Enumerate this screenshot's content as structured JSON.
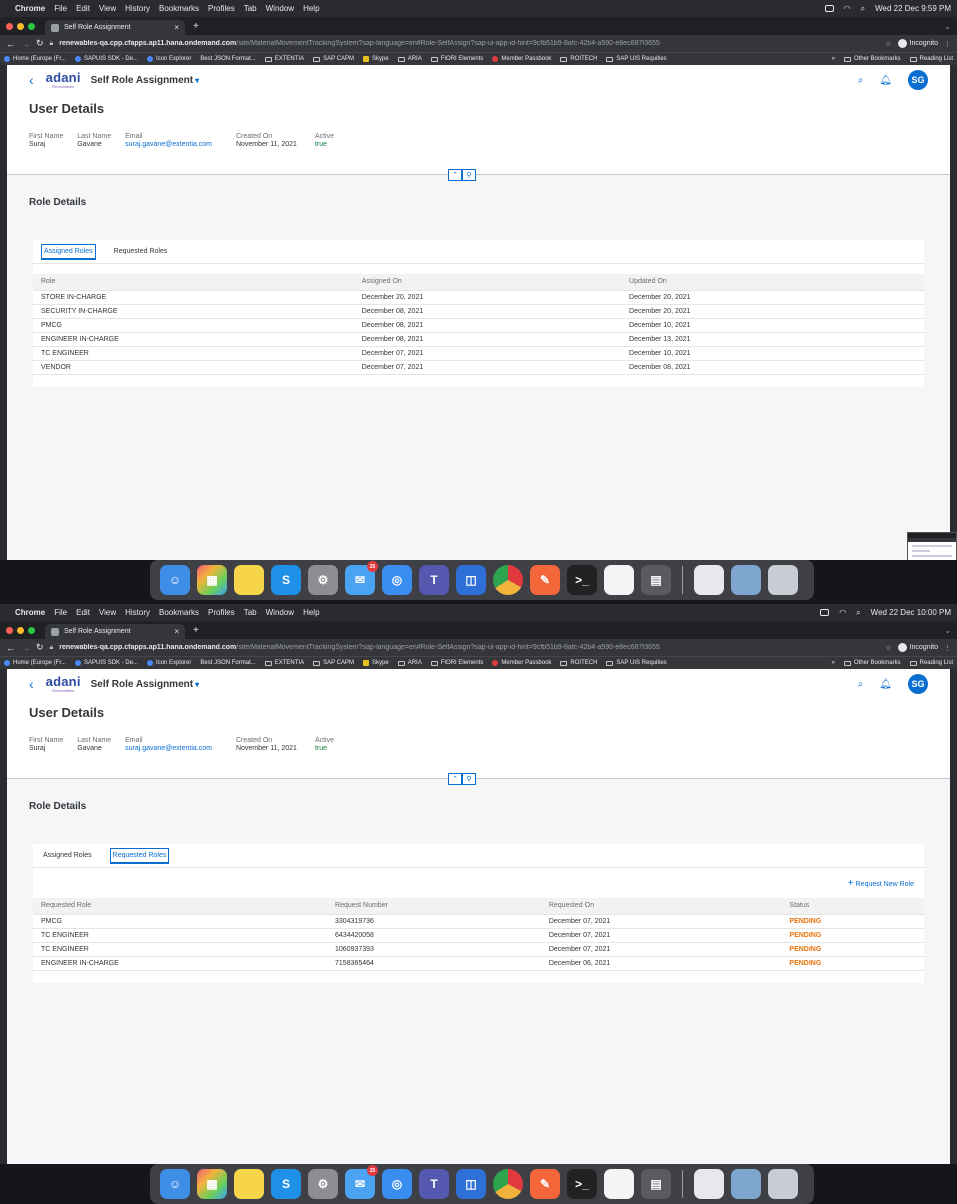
{
  "os": {
    "menu": [
      "Chrome",
      "File",
      "Edit",
      "View",
      "History",
      "Bookmarks",
      "Profiles",
      "Tab",
      "Window",
      "Help"
    ],
    "clock_1": "Wed 22 Dec 9:59 PM",
    "clock_2": "Wed 22 Dec 10:00 PM"
  },
  "browser": {
    "tab_title": "Self Role Assignment",
    "url_host": "renewables-qa.cpp.cfapps.ap11.hana.ondemand.com",
    "url_path": "/site/MaterialMovementTrackingSystem?sap-language=en#Role-SelfAssign?sap-ui-app-id-hint=9cfb51b9-8afc-42b4-a590-e8ec687f3655",
    "incognito": "Incognito",
    "bookmarks": [
      "Home (Europe (Fr...",
      "SAPUIS SDK - De...",
      "Icon Explorer",
      "Best JSON Format...",
      "EXTENTIA",
      "SAP CAPM",
      "Skype",
      "ARIA",
      "FIORI Elements",
      "Member Passbook",
      "ROITECH",
      "SAP UIS Requities"
    ],
    "bookmarks_more": "»",
    "other_bookmarks": "Other Bookmarks",
    "reading_list": "Reading List"
  },
  "app": {
    "logo": "adani",
    "logo_sub": "Renewables",
    "title": "Self Role Assignment",
    "avatar": "SG"
  },
  "user_details": {
    "title": "User Details",
    "first_name_label": "First Name",
    "first_name": "Suraj",
    "last_name_label": "Last Name",
    "last_name": "Gavane",
    "email_label": "Email",
    "email": "suraj.gavane@extentia.com",
    "created_label": "Created On",
    "created": "November 11, 2021",
    "active_label": "Active",
    "active": "true"
  },
  "role_details": {
    "title": "Role Details",
    "tabs": [
      "Assigned Roles",
      "Requested Roles"
    ]
  },
  "assigned": {
    "columns": [
      "Role",
      "Assigned On",
      "Updated On"
    ],
    "rows": [
      [
        "STORE IN-CHARGE",
        "December 20, 2021",
        "December 20, 2021"
      ],
      [
        "SECURITY IN-CHARGE",
        "December 08, 2021",
        "December 20, 2021"
      ],
      [
        "PMCG",
        "December 08, 2021",
        "December 10, 2021"
      ],
      [
        "ENGINEER IN-CHARGE",
        "December 08, 2021",
        "December 13, 2021"
      ],
      [
        "TC ENGINEER",
        "December 07, 2021",
        "December 10, 2021"
      ],
      [
        "VENDOR",
        "December 07, 2021",
        "December 08, 2021"
      ]
    ]
  },
  "requested": {
    "new_button": "Request New Role",
    "columns": [
      "Requested Role",
      "Request Number",
      "Requested On",
      "Status"
    ],
    "rows": [
      [
        "PMCG",
        "3304319736",
        "December 07, 2021",
        "PENDING"
      ],
      [
        "TC ENGINEER",
        "6434420058",
        "December 07, 2021",
        "PENDING"
      ],
      [
        "TC ENGINEER",
        "1060937393",
        "December 07, 2021",
        "PENDING"
      ],
      [
        "ENGINEER IN-CHARGE",
        "7158365464",
        "December 06, 2021",
        "PENDING"
      ]
    ]
  },
  "dock": {
    "mail_badge": "25",
    "terminal_glyph": ">_",
    "skype_glyph": "S"
  },
  "colors": {
    "accent": "#0a6ed1",
    "pending": "#e9730c",
    "active": "#107e3e"
  }
}
